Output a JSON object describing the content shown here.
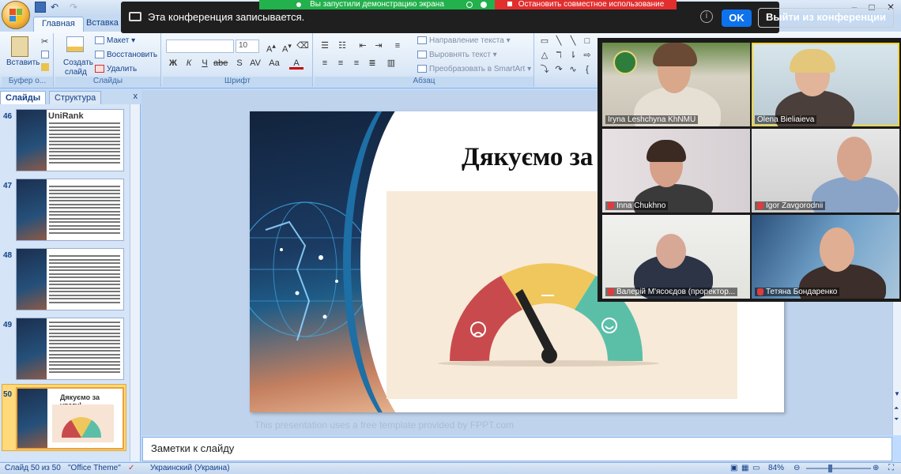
{
  "zoom": {
    "recording_text": "Эта конференция записывается.",
    "ok_label": "OK",
    "leave_label": "Выйти из конференции",
    "share_banner": "Вы запустили демонстрацию экрана",
    "stop_share": "Остановить совместное использование"
  },
  "ribbon": {
    "tabs": [
      "Главная",
      "Вставка"
    ],
    "clipboard": {
      "paste": "Вставить",
      "group": "Буфер о..."
    },
    "slides": {
      "create": "Создать",
      "create2": "слайд",
      "layout": "Макет",
      "reset": "Восстановить",
      "delete": "Удалить",
      "group": "Слайды"
    },
    "font": {
      "size": "10",
      "group": "Шрифт"
    },
    "paragraph": {
      "direction": "Направление текста",
      "align": "Выровнять текст",
      "smartart": "Преобразовать в SmartArt",
      "group": "Абзац"
    }
  },
  "panel": {
    "tab_slides": "Слайды",
    "tab_outline": "Структура",
    "close": "x",
    "thumbs": [
      {
        "num": "46",
        "title": "UniRank"
      },
      {
        "num": "47",
        "title": ""
      },
      {
        "num": "48",
        "title": ""
      },
      {
        "num": "49",
        "title": ""
      },
      {
        "num": "50",
        "title": "Дякуємо за увагу!"
      }
    ]
  },
  "slide": {
    "title": "Дякуємо за",
    "footer": "This presentation uses a free template provided by FPPT.com"
  },
  "notes": {
    "placeholder": "Заметки к слайду"
  },
  "status": {
    "slide_count": "Слайд 50 из 50",
    "theme": "\"Office Theme\"",
    "language": "Украинский (Украина)",
    "zoom": "84%"
  },
  "participants": [
    {
      "name": "Iryna Leshchyna KhNMU",
      "muted": false,
      "active": false
    },
    {
      "name": "Olena Bieliaieva",
      "muted": false,
      "active": true
    },
    {
      "name": "Inna Chukhno",
      "muted": true,
      "active": false
    },
    {
      "name": "Igor Zavgorodnii",
      "muted": true,
      "active": false
    },
    {
      "name": "Валерій М'ясоєдов (проректор...",
      "muted": true,
      "active": false
    },
    {
      "name": "Тетяна Бондаренко",
      "muted": true,
      "active": false
    }
  ],
  "colors": {
    "gauge_red": "#c94a4d",
    "gauge_yellow": "#f0c75c",
    "gauge_teal": "#5bbfa8",
    "accent_blue": "#0e72ed"
  }
}
